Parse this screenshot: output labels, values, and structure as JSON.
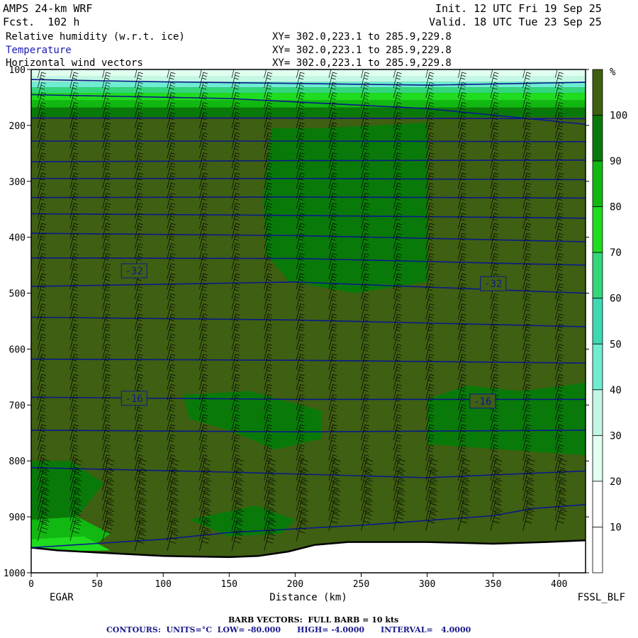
{
  "header": {
    "model": "AMPS 24-km WRF",
    "fcst": "Fcst.  102 h",
    "init": "Init. 12 UTC Fri 19 Sep 25",
    "valid": "Valid. 18 UTC Tue 23 Sep 25",
    "fields": [
      {
        "name": "Relative humidity (w.r.t. ice)",
        "xy": "XY= 302.0,223.1 to 285.9,229.8"
      },
      {
        "name": "Temperature",
        "xy": "XY= 302.0,223.1 to 285.9,229.8"
      },
      {
        "name": "Horizontal wind vectors",
        "xy": "XY= 302.0,223.1 to 285.9,229.8"
      }
    ]
  },
  "footer": {
    "barb": "BARB VECTORS:  FULL BARB = 10 kts",
    "contours": "CONTOURS:  UNITS=°C  LOW= -80.000      HIGH= -4.0000      INTERVAL=   4.0000"
  },
  "chart_data": {
    "type": "cross-section",
    "xlabel": "Distance (km)",
    "x_ticks": [
      0,
      50,
      100,
      150,
      200,
      250,
      300,
      350,
      400
    ],
    "xlim": [
      0,
      420
    ],
    "y_ticks": [
      100,
      200,
      300,
      400,
      500,
      600,
      700,
      800,
      900,
      1000
    ],
    "ylim": [
      1000,
      100
    ],
    "y_reversed": true,
    "left_endpoint": "EGAR",
    "right_endpoint": "FSSL_BLF",
    "colorbar": {
      "unit": "%",
      "levels": [
        10,
        20,
        30,
        40,
        50,
        60,
        70,
        80,
        90,
        100
      ],
      "colors": [
        "#ffffff",
        "#ffffff",
        "#e0ffef",
        "#c2f7e4",
        "#6eedd2",
        "#3dd9b5",
        "#33d67a",
        "#1fdc1f",
        "#12b812",
        "#097a09",
        "#3f5f12"
      ]
    },
    "temperature_labels": [
      {
        "text": "-32",
        "x": 78,
        "p": 460
      },
      {
        "text": "-32",
        "x": 350,
        "p": 483
      },
      {
        "text": "-16",
        "x": 78,
        "p": 688
      },
      {
        "text": "-16",
        "x": 342,
        "p": 693
      }
    ],
    "isotherms": [
      [
        [
          0,
          118
        ],
        [
          100,
          122
        ],
        [
          200,
          125
        ],
        [
          300,
          128
        ],
        [
          420,
          123
        ]
      ],
      [
        [
          0,
          145
        ],
        [
          150,
          152
        ],
        [
          300,
          170
        ],
        [
          420,
          198
        ]
      ],
      [
        [
          0,
          187
        ],
        [
          200,
          187
        ],
        [
          420,
          188
        ]
      ],
      [
        [
          0,
          228
        ],
        [
          200,
          228
        ],
        [
          420,
          229
        ]
      ],
      [
        [
          0,
          265
        ],
        [
          200,
          263
        ],
        [
          420,
          262
        ]
      ],
      [
        [
          0,
          295
        ],
        [
          200,
          295
        ],
        [
          420,
          297
        ]
      ],
      [
        [
          0,
          329
        ],
        [
          200,
          328
        ],
        [
          420,
          330
        ]
      ],
      [
        [
          0,
          358
        ],
        [
          200,
          361
        ],
        [
          420,
          366
        ]
      ],
      [
        [
          0,
          393
        ],
        [
          200,
          397
        ],
        [
          420,
          408
        ]
      ],
      [
        [
          0,
          437
        ],
        [
          200,
          438
        ],
        [
          420,
          450
        ]
      ],
      [
        [
          0,
          488
        ],
        [
          200,
          480
        ],
        [
          420,
          500
        ]
      ],
      [
        [
          0,
          543
        ],
        [
          200,
          548
        ],
        [
          420,
          560
        ]
      ],
      [
        [
          0,
          618
        ],
        [
          200,
          620
        ],
        [
          420,
          625
        ]
      ],
      [
        [
          0,
          686
        ],
        [
          200,
          690
        ],
        [
          420,
          690
        ]
      ],
      [
        [
          0,
          745
        ],
        [
          200,
          748
        ],
        [
          420,
          745
        ]
      ],
      [
        [
          0,
          812
        ],
        [
          150,
          820
        ],
        [
          300,
          830
        ],
        [
          420,
          818
        ]
      ],
      [
        [
          0,
          955
        ],
        [
          100,
          940
        ],
        [
          150,
          928
        ],
        [
          250,
          915
        ],
        [
          350,
          898
        ],
        [
          380,
          885
        ],
        [
          420,
          878
        ]
      ]
    ],
    "terrain": [
      [
        0,
        955
      ],
      [
        20,
        960
      ],
      [
        60,
        965
      ],
      [
        100,
        970
      ],
      [
        150,
        972
      ],
      [
        172,
        970
      ],
      [
        195,
        962
      ],
      [
        215,
        950
      ],
      [
        240,
        945
      ],
      [
        300,
        945
      ],
      [
        350,
        948
      ],
      [
        390,
        945
      ],
      [
        420,
        942
      ]
    ],
    "moist_regions": [
      [
        [
          182,
          205
        ],
        [
          220,
          205
        ],
        [
          300,
          195
        ],
        [
          300,
          480
        ],
        [
          245,
          500
        ],
        [
          195,
          478
        ],
        [
          178,
          430
        ],
        [
          176,
          330
        ]
      ],
      [
        [
          115,
          682
        ],
        [
          165,
          675
        ],
        [
          220,
          710
        ],
        [
          220,
          760
        ],
        [
          185,
          780
        ],
        [
          150,
          745
        ],
        [
          120,
          725
        ]
      ],
      [
        [
          300,
          690
        ],
        [
          330,
          665
        ],
        [
          370,
          675
        ],
        [
          405,
          665
        ],
        [
          420,
          660
        ],
        [
          420,
          790
        ],
        [
          300,
          770
        ]
      ],
      [
        [
          0,
          800
        ],
        [
          30,
          800
        ],
        [
          55,
          840
        ],
        [
          35,
          900
        ],
        [
          0,
          905
        ]
      ],
      [
        [
          120,
          905
        ],
        [
          170,
          880
        ],
        [
          200,
          905
        ],
        [
          190,
          930
        ],
        [
          150,
          935
        ]
      ]
    ]
  }
}
